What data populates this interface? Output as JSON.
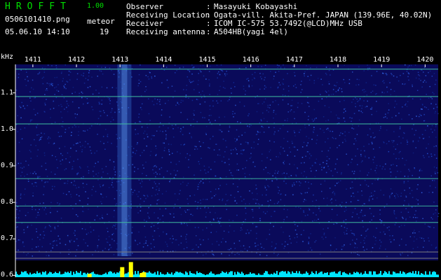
{
  "header": {
    "app_title": "HROFFT",
    "app_version": "1.00",
    "filename": "0506101410.png",
    "meteor_label": "meteor",
    "datetime": "05.06.10 14:10",
    "meteor_count": "19"
  },
  "info": [
    {
      "label": "Observer",
      "value": "Masayuki Kobayashi"
    },
    {
      "label": "Receiving Location",
      "value": "Ogata-vill. Akita-Pref. JAPAN (139.96E, 40.02N)"
    },
    {
      "label": "Receiver",
      "value": "ICOM IC-575 53.7492(@LCD)MHz USB"
    },
    {
      "label": "Receiving antenna",
      "value": "A504HB(yagi 4el)"
    }
  ],
  "colors": {
    "title_green": "#00e000",
    "spectrum_bg": "#0a0a5a",
    "grid": "#7f7f7f",
    "amplitude": "#00e5ff",
    "meteor_peak": "#ffff00",
    "band_line": "#40c0a0"
  },
  "chart_data": {
    "type": "heatmap",
    "ylabel": "kHz",
    "x_tick_labels": [
      "1411",
      "1412",
      "1413",
      "1414",
      "1415",
      "1416",
      "1417",
      "1418",
      "1419",
      "1420"
    ],
    "y_tick_labels": [
      "1.1",
      "1.0",
      "0.9",
      "0.8",
      "0.7",
      "0.6"
    ],
    "y_ticks": [
      1.1,
      1.0,
      0.9,
      0.8,
      0.7,
      0.6
    ],
    "x_ticks": [
      1411,
      1412,
      1413,
      1414,
      1415,
      1416,
      1417,
      1418,
      1419,
      1420
    ],
    "xlim": [
      1410.6,
      1420.3
    ],
    "ylim": [
      0.595,
      1.178
    ],
    "carrier_lines_khz": [
      1.165,
      1.09,
      1.015,
      0.865,
      0.79,
      0.745
    ],
    "meteor_time_min": [
      1413.1
    ],
    "amplitude_bars": [
      {
        "x": 1413.05,
        "v": 0.6
      },
      {
        "x": 1413.25,
        "v": 0.9
      },
      {
        "x": 1413.55,
        "v": 0.3
      },
      {
        "x": 1412.3,
        "v": 0.2
      },
      {
        "x": 1413.5,
        "v": 0.25
      }
    ]
  }
}
